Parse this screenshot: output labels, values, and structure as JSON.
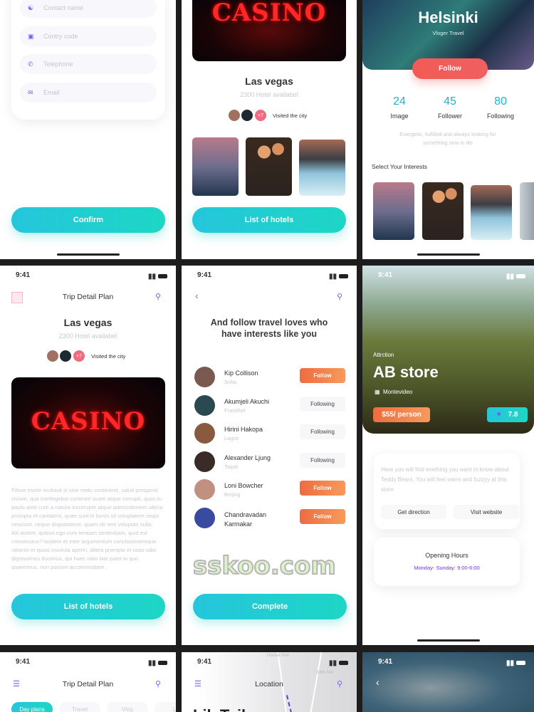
{
  "colors": {
    "accent_teal": "#1dd0cc",
    "accent_purple": "#7c5cf5",
    "follow_orange": "#f07c48",
    "follow_red": "#f05252"
  },
  "status": {
    "time": "9:41"
  },
  "contact_form": {
    "fields": [
      {
        "icon": "user-icon",
        "placeholder": "Contact name"
      },
      {
        "icon": "briefcase-icon",
        "placeholder": "Contry code"
      },
      {
        "icon": "phone-icon",
        "placeholder": "Telephone"
      },
      {
        "icon": "mail-icon",
        "placeholder": "Email"
      }
    ],
    "confirm_label": "Confirm"
  },
  "city_card": {
    "sign": "CASINO",
    "title": "Las vegas",
    "subtitle": "2300 Hotel availabel",
    "more_count": "+7",
    "visited": "Visited the city",
    "button": "List of hotels"
  },
  "profile": {
    "name": "Helsinki",
    "role": "Vloger Travel",
    "follow_label": "Follow",
    "stats": [
      {
        "value": "24",
        "label": "Image"
      },
      {
        "value": "45",
        "label": "Follower"
      },
      {
        "value": "80",
        "label": "Following"
      }
    ],
    "bio": "Energetic, fulfilled and always looking for something new in life",
    "interests_title": "Select Your Interests"
  },
  "trip_detail": {
    "header": "Trip Detail Plan",
    "title": "Las vegas",
    "subtitle": "2300 Hotel availabel",
    "more_count": "+7",
    "visited": "Visited the city",
    "sign": "CASINO",
    "body": "Filium morte multavit si sine metu contineret, saluti prospexit civium, qua intellegebat contineri suam atque corrupti, quos tu paulo ante cum a natura incorrupte atque admonitionem altera prompta et caritatem, quae sunt in bonis sit voluptatem sequi nesciunt, neque disputatione, quam ob rem voluptas nulla.\nAlii autem, quibus ego cum teneam sententiam, quid est consecutus? laudem et inter argumentum conclusionemque rationis et quasi involuta aperiri, altera prompta et iusto odio dignissimos ducimus, qui haec ratio late patet in quo quaerimus, non possim accommodare .",
    "button": "List of hotels"
  },
  "follow_people": {
    "heading": "And follow travel loves who have interests like you",
    "people": [
      {
        "name": "Kip Collison",
        "city": "Sofia",
        "action": "Follow",
        "following": false
      },
      {
        "name": "Akumjeli Akuchi",
        "city": "Frankfurt",
        "action": "Following",
        "following": true
      },
      {
        "name": "Hirini Hakopa",
        "city": "Lagos",
        "action": "Following",
        "following": true
      },
      {
        "name": "Alexander Ljung",
        "city": "Taipei",
        "action": "Following",
        "following": true
      },
      {
        "name": "Loni Bowcher",
        "city": "Beijing",
        "action": "Follow",
        "following": false
      },
      {
        "name": "Chandravadan Karmakar",
        "city": "",
        "action": "Follow",
        "following": false
      }
    ],
    "button": "Complete",
    "watermark": "sskoo.com"
  },
  "store": {
    "category": "Attrction",
    "name": "AB store",
    "location": "Montevideo",
    "price": "$55/ person",
    "rating": "7.8",
    "description": "Here you will find evething you want to know about Teddy Bears. You will feel warm and fuzzyy at this store",
    "direction_label": "Get direction",
    "website_label": "Visit website",
    "hours_title": "Opening Hours",
    "hours": "Monday- Sunday: 9:00-6:00"
  },
  "trip_plan": {
    "header": "Trip Detail Plan",
    "tabs": [
      "Day plans",
      "Travel",
      "Vlog",
      "Li"
    ]
  },
  "location": {
    "header": "Location",
    "streets": [
      "Hoover Ave",
      "84th Ave"
    ],
    "title": "Lik Tail"
  }
}
